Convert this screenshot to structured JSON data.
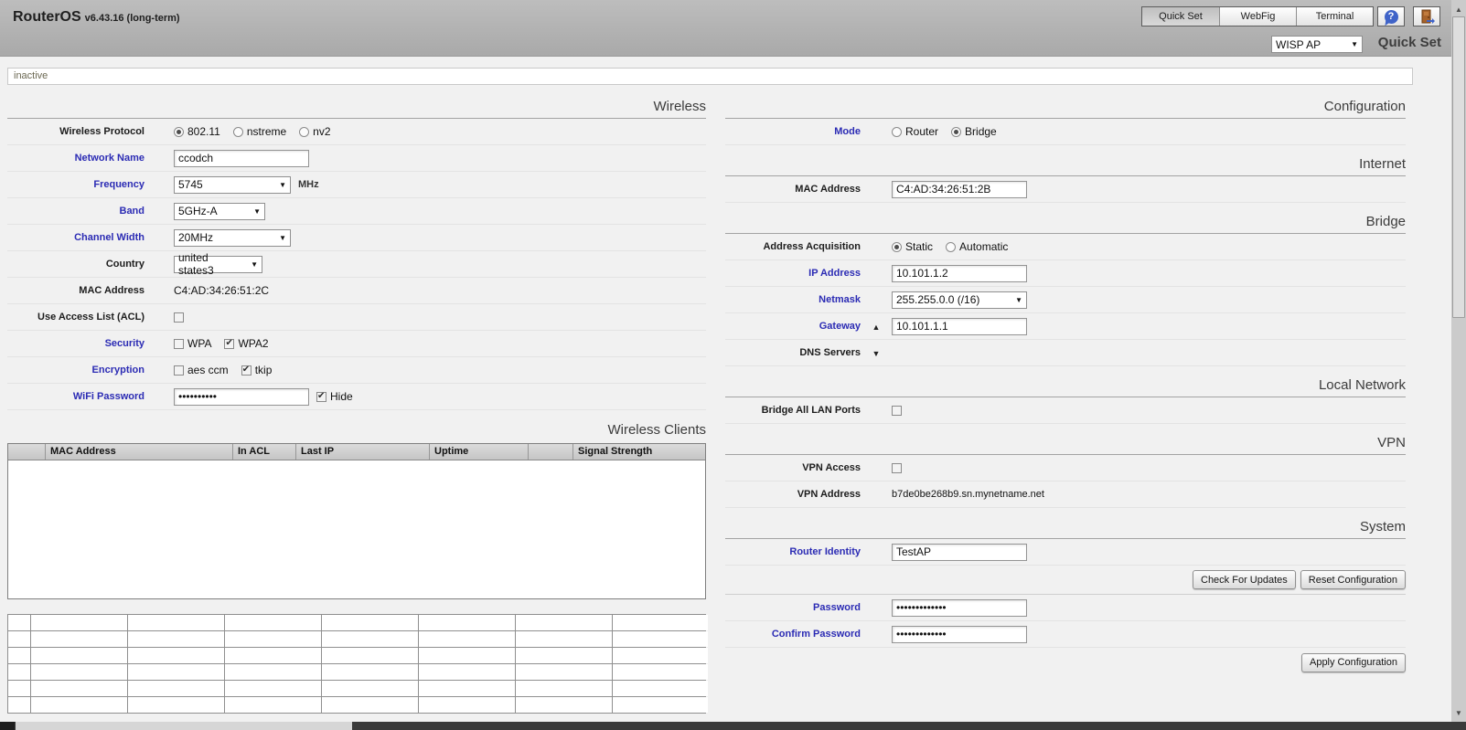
{
  "header": {
    "app_name": "RouterOS",
    "app_version": "v6.43.16 (long-term)",
    "tabs": [
      {
        "label": "Quick Set",
        "active": true
      },
      {
        "label": "WebFig",
        "active": false
      },
      {
        "label": "Terminal",
        "active": false
      }
    ],
    "preset_dropdown": {
      "value": "WISP AP"
    },
    "page_title": "Quick Set"
  },
  "status_bar": {
    "text": "inactive"
  },
  "wireless": {
    "title": "Wireless",
    "protocol": {
      "label": "Wireless Protocol",
      "options": [
        {
          "label": "802.11",
          "checked": true
        },
        {
          "label": "nstreme",
          "checked": false
        },
        {
          "label": "nv2",
          "checked": false
        }
      ]
    },
    "network_name": {
      "label": "Network Name",
      "value": "ccodch"
    },
    "frequency": {
      "label": "Frequency",
      "value": "5745",
      "unit": "MHz"
    },
    "band": {
      "label": "Band",
      "value": "5GHz-A"
    },
    "channel_width": {
      "label": "Channel Width",
      "value": "20MHz"
    },
    "country": {
      "label": "Country",
      "value": "united states3"
    },
    "mac_address": {
      "label": "MAC Address",
      "value": "C4:AD:34:26:51:2C"
    },
    "use_access_list": {
      "label": "Use Access List (ACL)",
      "checked": false
    },
    "security": {
      "label": "Security",
      "options": [
        {
          "label": "WPA",
          "checked": false
        },
        {
          "label": "WPA2",
          "checked": true
        }
      ]
    },
    "encryption": {
      "label": "Encryption",
      "options": [
        {
          "label": "aes ccm",
          "checked": false
        },
        {
          "label": "tkip",
          "checked": true
        }
      ]
    },
    "wifi_password": {
      "label": "WiFi Password",
      "value": "••••••••••",
      "hide": {
        "label": "Hide",
        "checked": true
      }
    }
  },
  "wireless_clients": {
    "title": "Wireless Clients",
    "columns": [
      "",
      "MAC Address",
      "In ACL",
      "Last IP",
      "Uptime",
      "",
      "Signal Strength"
    ],
    "rows": []
  },
  "configuration": {
    "title": "Configuration",
    "mode": {
      "label": "Mode",
      "options": [
        {
          "label": "Router",
          "checked": false
        },
        {
          "label": "Bridge",
          "checked": true
        }
      ]
    }
  },
  "internet": {
    "title": "Internet",
    "mac_address": {
      "label": "MAC Address",
      "value": "C4:AD:34:26:51:2B"
    }
  },
  "bridge": {
    "title": "Bridge",
    "address_acquisition": {
      "label": "Address Acquisition",
      "options": [
        {
          "label": "Static",
          "checked": true
        },
        {
          "label": "Automatic",
          "checked": false
        }
      ]
    },
    "ip_address": {
      "label": "IP Address",
      "value": "10.101.1.2"
    },
    "netmask": {
      "label": "Netmask",
      "value": "255.255.0.0 (/16)"
    },
    "gateway": {
      "label": "Gateway",
      "value": "10.101.1.1"
    },
    "dns_servers": {
      "label": "DNS Servers"
    }
  },
  "local_network": {
    "title": "Local Network",
    "bridge_all_lan_ports": {
      "label": "Bridge All LAN Ports",
      "checked": false
    }
  },
  "vpn": {
    "title": "VPN",
    "vpn_access": {
      "label": "VPN Access",
      "checked": false
    },
    "vpn_address": {
      "label": "VPN Address",
      "value": "b7de0be268b9.sn.mynetname.net"
    }
  },
  "system": {
    "title": "System",
    "router_identity": {
      "label": "Router Identity",
      "value": "TestAP"
    },
    "check_for_updates": "Check For Updates",
    "reset_configuration": "Reset Configuration",
    "password": {
      "label": "Password",
      "value": "•••••••••••••"
    },
    "confirm_password": {
      "label": "Confirm Password",
      "value": "•••••••••••••"
    },
    "apply_configuration": "Apply Configuration"
  },
  "bottom_grid": {
    "rows": 6,
    "cols": 8
  }
}
